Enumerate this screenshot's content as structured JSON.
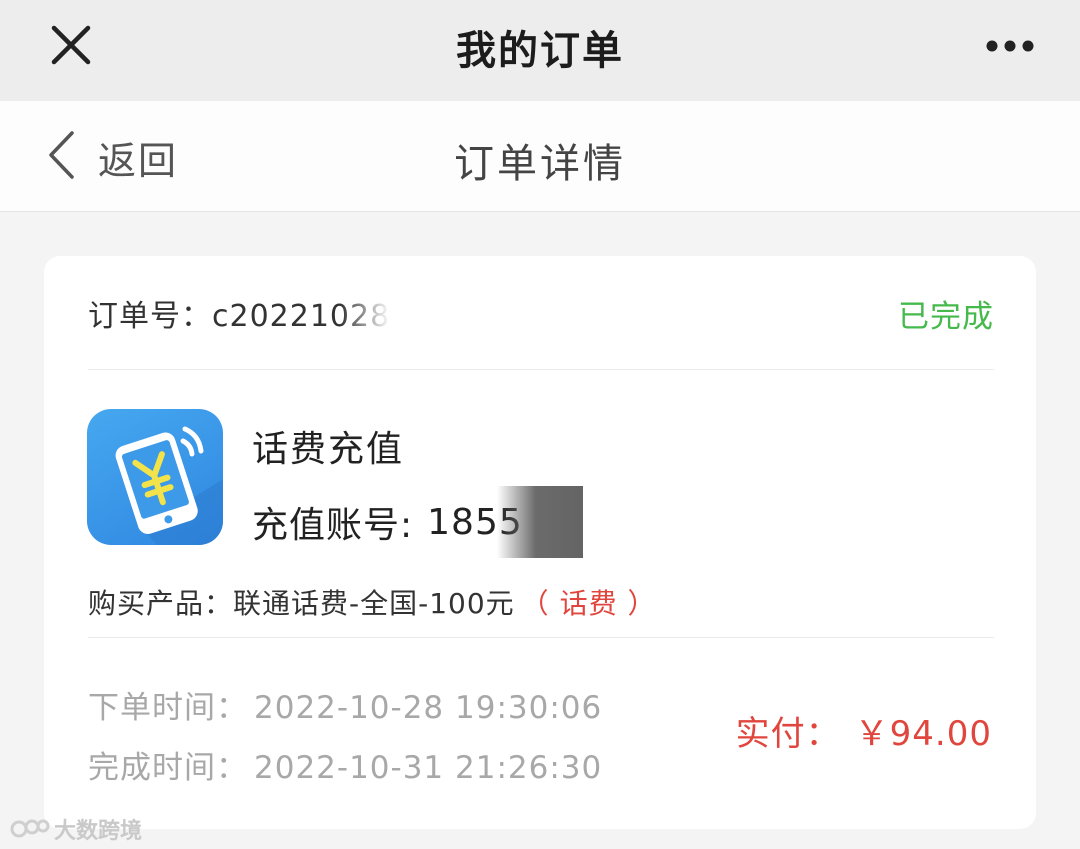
{
  "topbar": {
    "title": "我的订单",
    "close_icon": "close-icon",
    "more_icon": "more-dots-icon"
  },
  "subheader": {
    "back_label": "返回",
    "page_title": "订单详情"
  },
  "order": {
    "number_label": "订单号：",
    "number_value": "c20221028",
    "status": "已完成",
    "product_name": "话费充值",
    "account_label": "充值账号:",
    "account_value": "1855",
    "purchase_label": "购买产品：",
    "purchase_value": "联通话费-全国-100元",
    "purchase_tag": "（ 话费 ）",
    "order_time_label": "下单时间：",
    "order_time": "2022-10-28 19:30:06",
    "complete_time_label": "完成时间：",
    "complete_time": "2022-10-31 21:26:30",
    "paid_label": "实付：",
    "paid_amount": "￥94.00"
  },
  "colors": {
    "status_green": "#46b94d",
    "accent_red": "#e0463d",
    "icon_blue": "#3a98e8"
  },
  "watermark": "大数跨境"
}
